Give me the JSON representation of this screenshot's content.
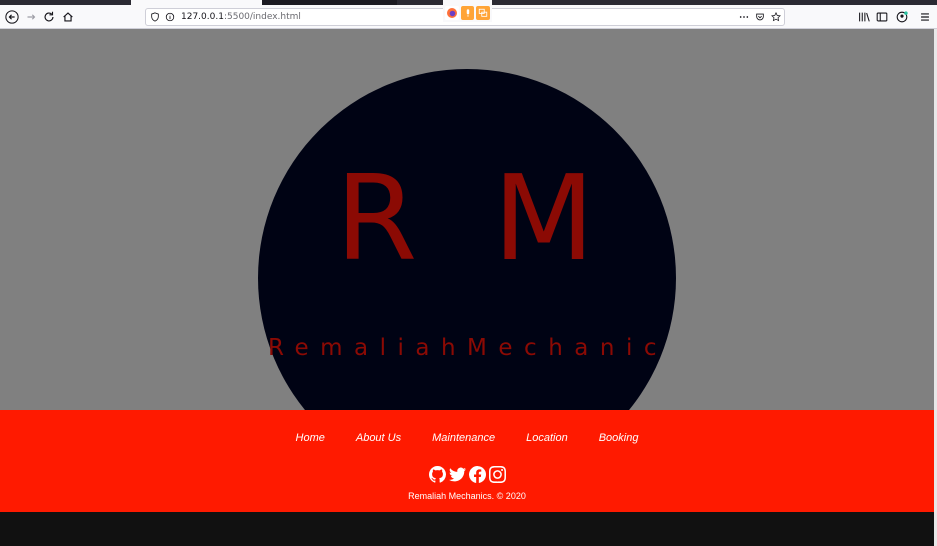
{
  "browser": {
    "url_host": "127.0.0.1",
    "url_rest": ":5500/index.html"
  },
  "hero": {
    "logo_letters": "R M",
    "logo_name": "RemaliahMechanic"
  },
  "footer": {
    "nav": [
      "Home",
      "About Us",
      "Maintenance",
      "Location",
      "Booking"
    ],
    "social_icons": [
      "github-icon",
      "twitter-icon",
      "facebook-icon",
      "instagram-icon"
    ],
    "copyright": "Remaliah Mechanics. © 2020"
  },
  "colors": {
    "hero_bg": "#808080",
    "circle": "#000314",
    "logo_text": "#8b0a04",
    "footer_bg": "#ff1a00"
  }
}
